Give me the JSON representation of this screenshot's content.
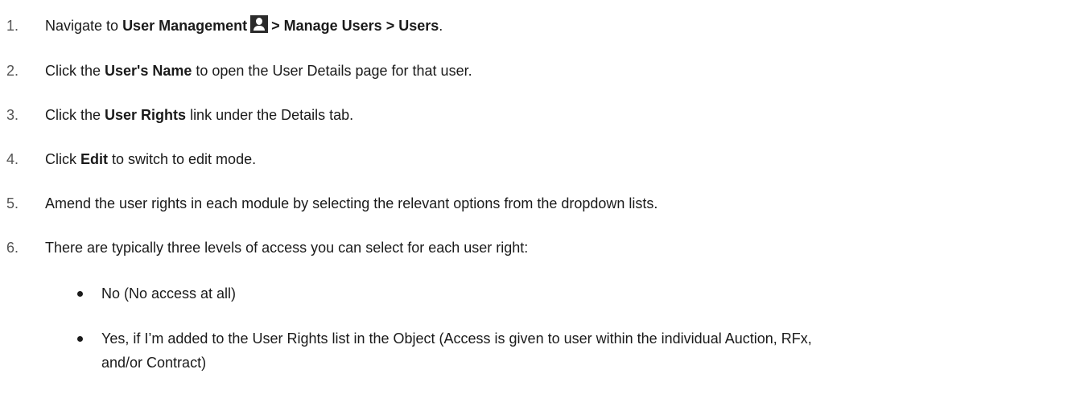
{
  "steps": [
    {
      "num": "1.",
      "pre": "Navigate to ",
      "b1": "User Management",
      "b2": "> Manage Users > Users",
      "post": "."
    },
    {
      "num": "2.",
      "pre": "Click the ",
      "b1": "User's Name",
      "post": " to open the User Details page for that user."
    },
    {
      "num": "3.",
      "pre": "Click the ",
      "b1": "User Rights",
      "post": " link under the Details tab."
    },
    {
      "num": "4.",
      "pre": "Click ",
      "b1": "Edit",
      "post": " to switch to edit mode."
    },
    {
      "num": "5.",
      "text": "Amend the user rights in each module by selecting the relevant options from the dropdown lists."
    },
    {
      "num": "6.",
      "text": "There are typically three levels of access you can select for each user right:"
    }
  ],
  "bullets": [
    {
      "text": "No (No access at all)"
    },
    {
      "line1": "Yes, if I’m added to the User Rights list in the Object (Access is given to user within the individual Auction, RFx,",
      "line2": "and/or Contract)"
    }
  ],
  "icons": {
    "user_management": "user-icon"
  }
}
